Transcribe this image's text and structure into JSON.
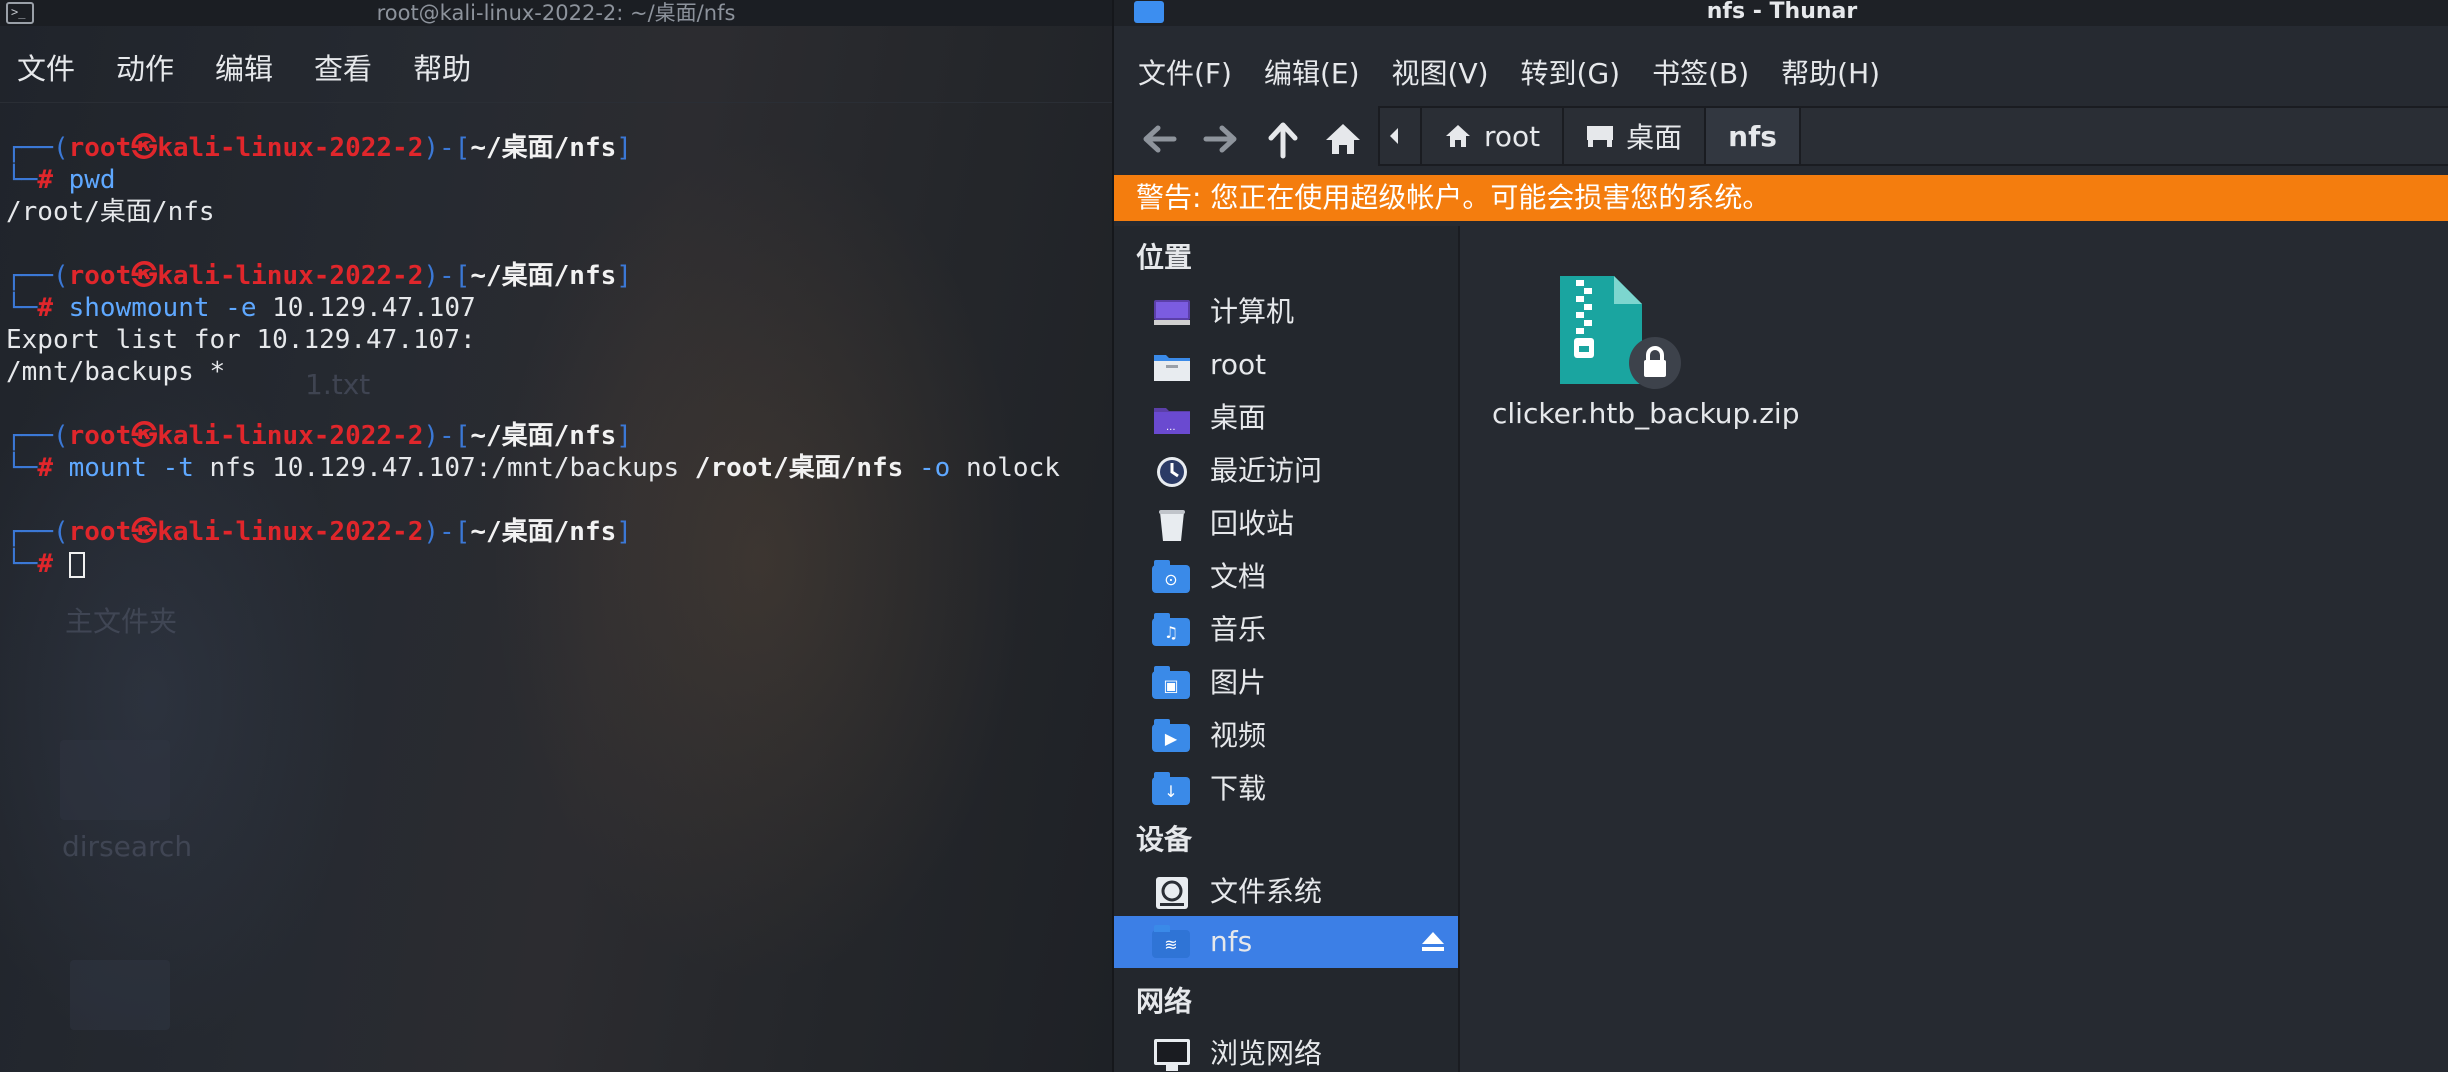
{
  "terminal": {
    "title": "root@kali-linux-2022-2: ~/桌面/nfs",
    "menu": [
      "文件",
      "动作",
      "编辑",
      "查看",
      "帮助"
    ],
    "prompt": {
      "user_host": "root㉿kali-linux-2022-2",
      "path": "~/桌面/nfs",
      "hash": "#"
    },
    "lines": {
      "cmd1": "pwd",
      "out1": "/root/桌面/nfs",
      "cmd2_name": "showmount",
      "cmd2_opt": "-e",
      "cmd2_arg": "10.129.47.107",
      "out2a": "Export list for 10.129.47.107:",
      "out2b": "/mnt/backups *",
      "cmd3_name": "mount",
      "cmd3_opt1": "-t",
      "cmd3_mid": "nfs 10.129.47.107:/mnt/backups",
      "cmd3_path": "/root/桌面/nfs",
      "cmd3_opt2": "-o",
      "cmd3_end": "nolock"
    },
    "desktop_labels": [
      "1.txt",
      "主文件夹",
      "dirsearch"
    ]
  },
  "thunar": {
    "title": "nfs - Thunar",
    "menu": [
      "文件(F)",
      "编辑(E)",
      "视图(V)",
      "转到(G)",
      "书签(B)",
      "帮助(H)"
    ],
    "toolbar_icons": [
      "back-icon",
      "forward-icon",
      "up-icon",
      "home-icon"
    ],
    "path": [
      "root",
      "桌面",
      "nfs"
    ],
    "warning": "警告: 您正在使用超级帐户。可能会损害您的系统。",
    "sidebar": {
      "places_title": "位置",
      "places": [
        "计算机",
        "root",
        "桌面",
        "最近访问",
        "回收站",
        "文档",
        "音乐",
        "图片",
        "视频",
        "下载"
      ],
      "devices_title": "设备",
      "devices": [
        "文件系统",
        "nfs"
      ],
      "network_title": "网络",
      "network": [
        "浏览网络"
      ]
    },
    "files": [
      {
        "name": "clicker.htb_backup.zip",
        "icon": "zip-archive-icon",
        "locked": true
      }
    ],
    "colors": {
      "warning": "#f47d0e",
      "selection": "#3c7fe6",
      "folder": "#3a8ae8",
      "zip": "#1aa5a0"
    }
  }
}
